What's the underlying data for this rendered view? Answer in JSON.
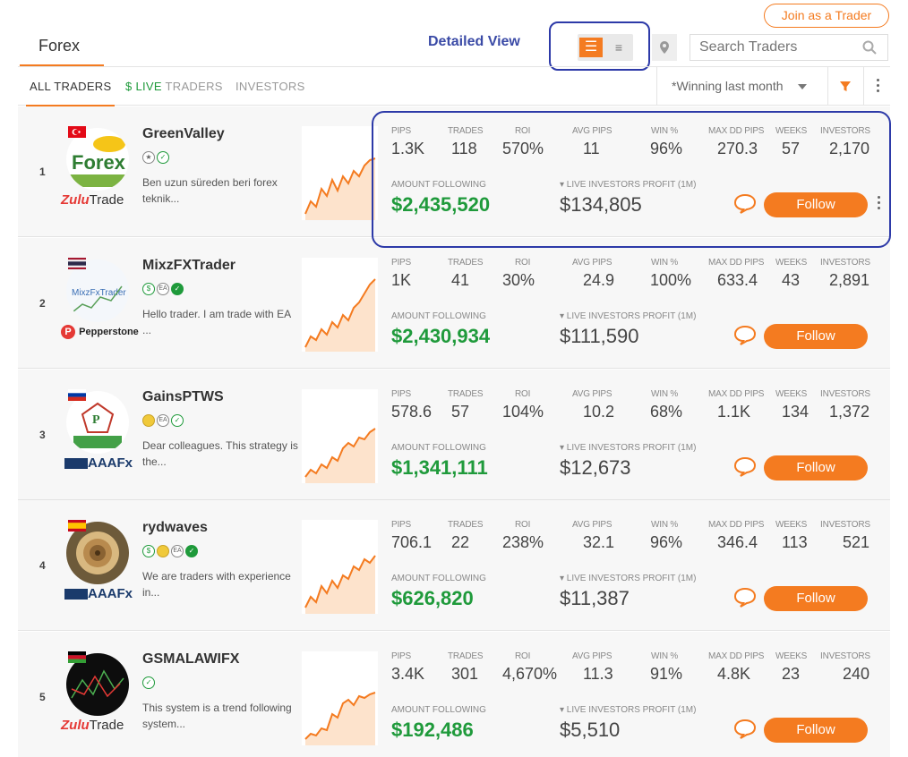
{
  "header": {
    "join_label": "Join as a Trader",
    "tab_label": "Forex",
    "view_label": "Detailed View",
    "search_placeholder": "Search Traders"
  },
  "subtabs": {
    "all": "ALL TRADERS",
    "live_dollar": "$",
    "live_word": "LIVE",
    "live_rest": " TRADERS",
    "investors": "INVESTORS",
    "sort_label": "*Winning last month"
  },
  "colors": {
    "accent": "#f47b20",
    "green": "#1f9a3b",
    "annotation": "#2d3aa8"
  },
  "stat_labels": {
    "pips": "PIPS",
    "trades": "TRADES",
    "roi": "ROI",
    "avg_pips": "AVG PIPS",
    "win": "WIN %",
    "max_dd": "MAX DD PIPS",
    "weeks": "WEEKS",
    "investors": "INVESTORS",
    "amount_following": "AMOUNT FOLLOWING",
    "live_profit": "▾ LIVE INVESTORS PROFIT (1M)",
    "follow": "Follow"
  },
  "traders": [
    {
      "rank": "1",
      "name": "GreenValley",
      "broker": "ZuluTrade",
      "desc": "Ben uzun süreden beri forex teknik...",
      "flag": "turkey",
      "pips": "1.3K",
      "trades": "118",
      "roi": "570%",
      "avg_pips": "11",
      "win": "96%",
      "max_dd": "270.3",
      "weeks": "57",
      "investors": "2,170",
      "amount": "$2,435,520",
      "profit": "$134,805"
    },
    {
      "rank": "2",
      "name": "MixzFXTrader",
      "broker": "Pepperstone",
      "desc": "Hello trader. I am  trade with EA ...",
      "flag": "thailand",
      "pips": "1K",
      "trades": "41",
      "roi": "30%",
      "avg_pips": "24.9",
      "win": "100%",
      "max_dd": "633.4",
      "weeks": "43",
      "investors": "2,891",
      "amount": "$2,430,934",
      "profit": "$111,590"
    },
    {
      "rank": "3",
      "name": "GainsPTWS",
      "broker": "AAAFx",
      "desc": "Dear colleagues. This strategy is the...",
      "flag": "russia",
      "pips": "578.6",
      "trades": "57",
      "roi": "104%",
      "avg_pips": "10.2",
      "win": "68%",
      "max_dd": "1.1K",
      "weeks": "134",
      "investors": "1,372",
      "amount": "$1,341,111",
      "profit": "$12,673"
    },
    {
      "rank": "4",
      "name": "rydwaves",
      "broker": "AAAFx",
      "desc": "We are traders with experience in...",
      "flag": "spain",
      "pips": "706.1",
      "trades": "22",
      "roi": "238%",
      "avg_pips": "32.1",
      "win": "96%",
      "max_dd": "346.4",
      "weeks": "113",
      "investors": "521",
      "amount": "$626,820",
      "profit": "$11,387"
    },
    {
      "rank": "5",
      "name": "GSMALAWIFX",
      "broker": "ZuluTrade",
      "desc": "This system is a trend following system...",
      "flag": "malawi",
      "pips": "3.4K",
      "trades": "301",
      "roi": "4,670%",
      "avg_pips": "11.3",
      "win": "91%",
      "max_dd": "4.8K",
      "weeks": "23",
      "investors": "240",
      "amount": "$192,486",
      "profit": "$5,510"
    }
  ]
}
